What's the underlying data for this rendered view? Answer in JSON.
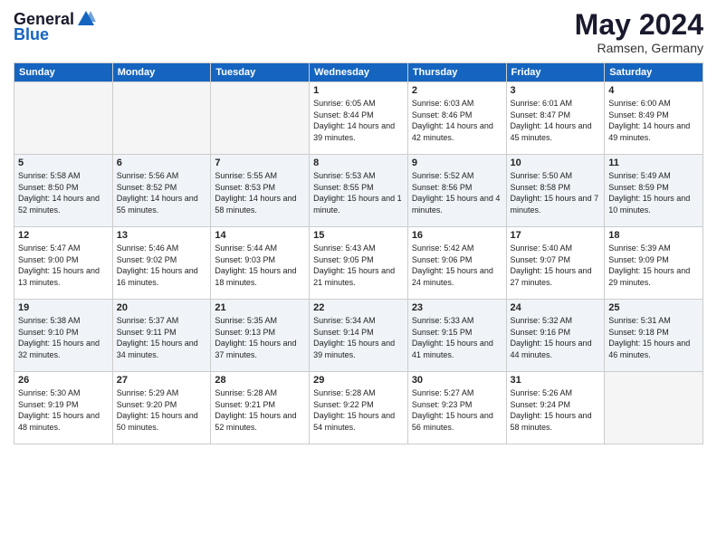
{
  "header": {
    "logo_general": "General",
    "logo_blue": "Blue",
    "month": "May 2024",
    "location": "Ramsen, Germany"
  },
  "weekdays": [
    "Sunday",
    "Monday",
    "Tuesday",
    "Wednesday",
    "Thursday",
    "Friday",
    "Saturday"
  ],
  "weeks": [
    [
      {
        "day": "",
        "sunrise": "",
        "sunset": "",
        "daylight": ""
      },
      {
        "day": "",
        "sunrise": "",
        "sunset": "",
        "daylight": ""
      },
      {
        "day": "",
        "sunrise": "",
        "sunset": "",
        "daylight": ""
      },
      {
        "day": "1",
        "sunrise": "Sunrise: 6:05 AM",
        "sunset": "Sunset: 8:44 PM",
        "daylight": "Daylight: 14 hours and 39 minutes."
      },
      {
        "day": "2",
        "sunrise": "Sunrise: 6:03 AM",
        "sunset": "Sunset: 8:46 PM",
        "daylight": "Daylight: 14 hours and 42 minutes."
      },
      {
        "day": "3",
        "sunrise": "Sunrise: 6:01 AM",
        "sunset": "Sunset: 8:47 PM",
        "daylight": "Daylight: 14 hours and 45 minutes."
      },
      {
        "day": "4",
        "sunrise": "Sunrise: 6:00 AM",
        "sunset": "Sunset: 8:49 PM",
        "daylight": "Daylight: 14 hours and 49 minutes."
      }
    ],
    [
      {
        "day": "5",
        "sunrise": "Sunrise: 5:58 AM",
        "sunset": "Sunset: 8:50 PM",
        "daylight": "Daylight: 14 hours and 52 minutes."
      },
      {
        "day": "6",
        "sunrise": "Sunrise: 5:56 AM",
        "sunset": "Sunset: 8:52 PM",
        "daylight": "Daylight: 14 hours and 55 minutes."
      },
      {
        "day": "7",
        "sunrise": "Sunrise: 5:55 AM",
        "sunset": "Sunset: 8:53 PM",
        "daylight": "Daylight: 14 hours and 58 minutes."
      },
      {
        "day": "8",
        "sunrise": "Sunrise: 5:53 AM",
        "sunset": "Sunset: 8:55 PM",
        "daylight": "Daylight: 15 hours and 1 minute."
      },
      {
        "day": "9",
        "sunrise": "Sunrise: 5:52 AM",
        "sunset": "Sunset: 8:56 PM",
        "daylight": "Daylight: 15 hours and 4 minutes."
      },
      {
        "day": "10",
        "sunrise": "Sunrise: 5:50 AM",
        "sunset": "Sunset: 8:58 PM",
        "daylight": "Daylight: 15 hours and 7 minutes."
      },
      {
        "day": "11",
        "sunrise": "Sunrise: 5:49 AM",
        "sunset": "Sunset: 8:59 PM",
        "daylight": "Daylight: 15 hours and 10 minutes."
      }
    ],
    [
      {
        "day": "12",
        "sunrise": "Sunrise: 5:47 AM",
        "sunset": "Sunset: 9:00 PM",
        "daylight": "Daylight: 15 hours and 13 minutes."
      },
      {
        "day": "13",
        "sunrise": "Sunrise: 5:46 AM",
        "sunset": "Sunset: 9:02 PM",
        "daylight": "Daylight: 15 hours and 16 minutes."
      },
      {
        "day": "14",
        "sunrise": "Sunrise: 5:44 AM",
        "sunset": "Sunset: 9:03 PM",
        "daylight": "Daylight: 15 hours and 18 minutes."
      },
      {
        "day": "15",
        "sunrise": "Sunrise: 5:43 AM",
        "sunset": "Sunset: 9:05 PM",
        "daylight": "Daylight: 15 hours and 21 minutes."
      },
      {
        "day": "16",
        "sunrise": "Sunrise: 5:42 AM",
        "sunset": "Sunset: 9:06 PM",
        "daylight": "Daylight: 15 hours and 24 minutes."
      },
      {
        "day": "17",
        "sunrise": "Sunrise: 5:40 AM",
        "sunset": "Sunset: 9:07 PM",
        "daylight": "Daylight: 15 hours and 27 minutes."
      },
      {
        "day": "18",
        "sunrise": "Sunrise: 5:39 AM",
        "sunset": "Sunset: 9:09 PM",
        "daylight": "Daylight: 15 hours and 29 minutes."
      }
    ],
    [
      {
        "day": "19",
        "sunrise": "Sunrise: 5:38 AM",
        "sunset": "Sunset: 9:10 PM",
        "daylight": "Daylight: 15 hours and 32 minutes."
      },
      {
        "day": "20",
        "sunrise": "Sunrise: 5:37 AM",
        "sunset": "Sunset: 9:11 PM",
        "daylight": "Daylight: 15 hours and 34 minutes."
      },
      {
        "day": "21",
        "sunrise": "Sunrise: 5:35 AM",
        "sunset": "Sunset: 9:13 PM",
        "daylight": "Daylight: 15 hours and 37 minutes."
      },
      {
        "day": "22",
        "sunrise": "Sunrise: 5:34 AM",
        "sunset": "Sunset: 9:14 PM",
        "daylight": "Daylight: 15 hours and 39 minutes."
      },
      {
        "day": "23",
        "sunrise": "Sunrise: 5:33 AM",
        "sunset": "Sunset: 9:15 PM",
        "daylight": "Daylight: 15 hours and 41 minutes."
      },
      {
        "day": "24",
        "sunrise": "Sunrise: 5:32 AM",
        "sunset": "Sunset: 9:16 PM",
        "daylight": "Daylight: 15 hours and 44 minutes."
      },
      {
        "day": "25",
        "sunrise": "Sunrise: 5:31 AM",
        "sunset": "Sunset: 9:18 PM",
        "daylight": "Daylight: 15 hours and 46 minutes."
      }
    ],
    [
      {
        "day": "26",
        "sunrise": "Sunrise: 5:30 AM",
        "sunset": "Sunset: 9:19 PM",
        "daylight": "Daylight: 15 hours and 48 minutes."
      },
      {
        "day": "27",
        "sunrise": "Sunrise: 5:29 AM",
        "sunset": "Sunset: 9:20 PM",
        "daylight": "Daylight: 15 hours and 50 minutes."
      },
      {
        "day": "28",
        "sunrise": "Sunrise: 5:28 AM",
        "sunset": "Sunset: 9:21 PM",
        "daylight": "Daylight: 15 hours and 52 minutes."
      },
      {
        "day": "29",
        "sunrise": "Sunrise: 5:28 AM",
        "sunset": "Sunset: 9:22 PM",
        "daylight": "Daylight: 15 hours and 54 minutes."
      },
      {
        "day": "30",
        "sunrise": "Sunrise: 5:27 AM",
        "sunset": "Sunset: 9:23 PM",
        "daylight": "Daylight: 15 hours and 56 minutes."
      },
      {
        "day": "31",
        "sunrise": "Sunrise: 5:26 AM",
        "sunset": "Sunset: 9:24 PM",
        "daylight": "Daylight: 15 hours and 58 minutes."
      },
      {
        "day": "",
        "sunrise": "",
        "sunset": "",
        "daylight": ""
      }
    ]
  ]
}
